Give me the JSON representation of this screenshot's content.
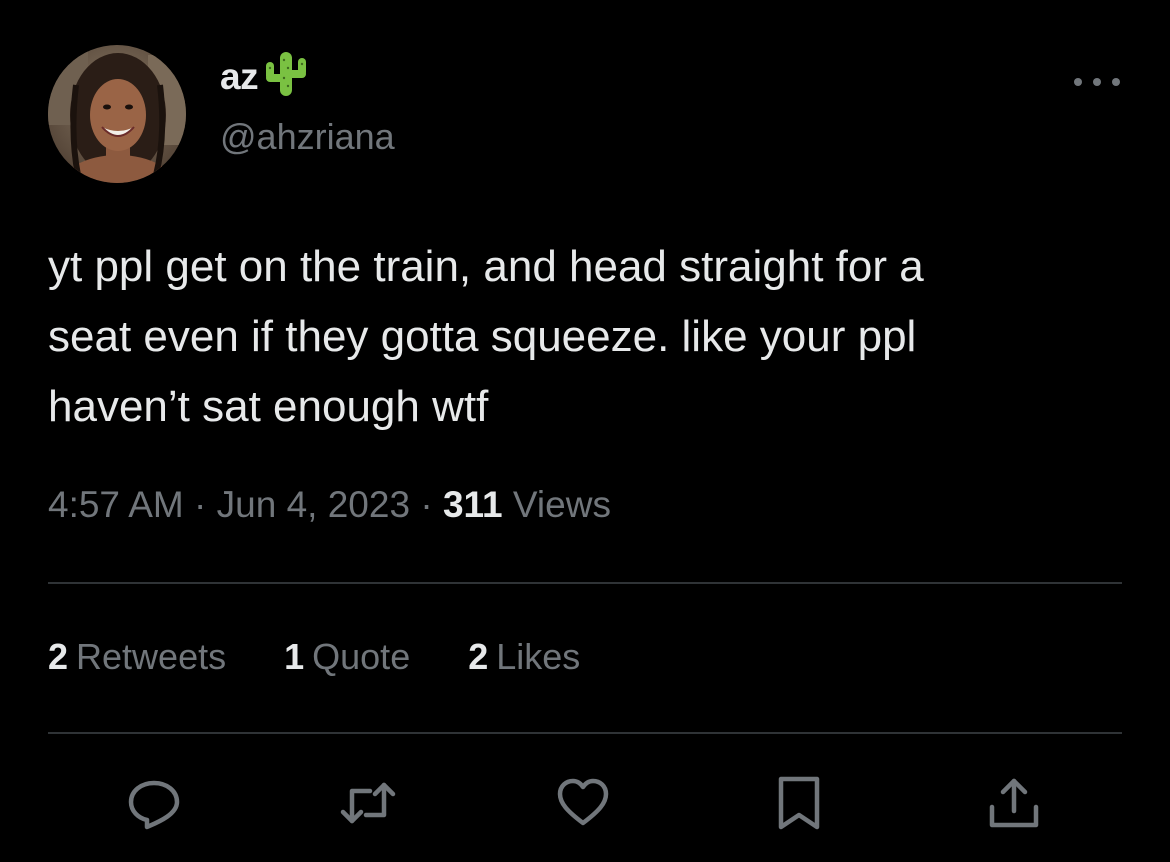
{
  "author": {
    "display_name": "az",
    "handle": "@ahzriana",
    "name_emoji": "cactus-icon"
  },
  "tweet": {
    "text": "yt ppl get on the train, and head straight for a\nseat even if they gotta squeeze. like your ppl\nhaven’t sat enough wtf",
    "time": "4:57 AM",
    "separator": "·",
    "date": "Jun 4, 2023",
    "views_count": "311",
    "views_label": "Views"
  },
  "stats": {
    "retweets_count": "2",
    "retweets_label": "Retweets",
    "quotes_count": "1",
    "quotes_label": "Quote",
    "likes_count": "2",
    "likes_label": "Likes"
  },
  "actions": [
    "reply-icon",
    "retweet-icon",
    "like-icon",
    "bookmark-icon",
    "share-icon"
  ],
  "colors": {
    "background": "#000000",
    "primary_text": "#e7e9ea",
    "secondary_text": "#71767b",
    "divider": "#2f3336",
    "cactus": "#7ac142"
  }
}
